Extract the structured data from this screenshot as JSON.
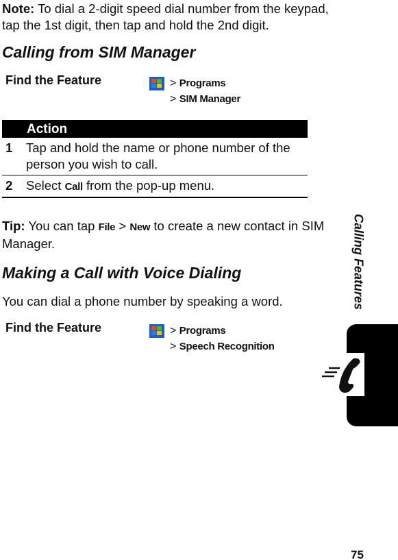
{
  "note": {
    "label": "Note:",
    "text": " To dial a 2-digit speed dial number from the keypad, tap the 1st digit, then tap and hold the 2nd digit."
  },
  "section1": {
    "title": "Calling from SIM Manager",
    "find_label": "Find the Feature",
    "path": [
      "Programs",
      "SIM Manager"
    ],
    "table": {
      "header": "Action",
      "rows": [
        {
          "num": "1",
          "text": "Tap and hold the name or phone number of the person you wish to call."
        },
        {
          "num": "2",
          "pre": "Select ",
          "cmd": "Call",
          "post": " from the pop-up menu."
        }
      ]
    }
  },
  "tip": {
    "label": "Tip:",
    "pre": " You can tap ",
    "cmd1": "File",
    "sep": " > ",
    "cmd2": "New",
    "post": " to create a new contact in SIM Manager."
  },
  "section2": {
    "title": "Making a Call with Voice Dialing",
    "intro": "You can dial a phone number by speaking a word.",
    "find_label": "Find the Feature",
    "path": [
      "Programs",
      "Speech Recognition"
    ]
  },
  "side_tab": {
    "label": "Calling Features",
    "icon": "phone-icon"
  },
  "page_number": "75"
}
